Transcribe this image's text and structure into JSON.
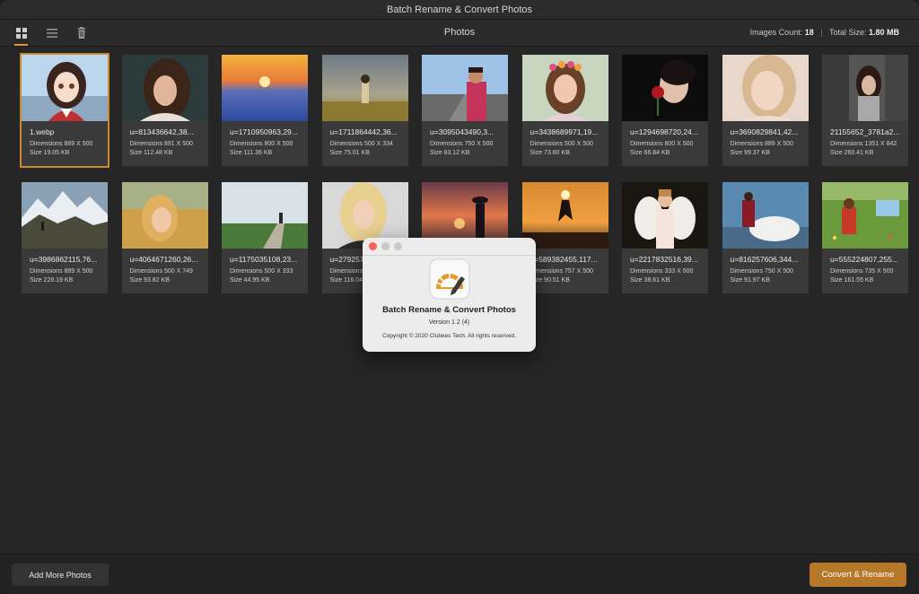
{
  "window": {
    "title": "Batch Rename & Convert Photos"
  },
  "toolbar": {
    "title": "Photos",
    "images_count_label": "Images Count:",
    "images_count_value": "18",
    "total_size_label": "Total Size:",
    "total_size_value": "1.80 MB",
    "view_mode": "grid"
  },
  "photos": [
    {
      "name": "1.webp",
      "dimensions": "Dimensions 889 X 500",
      "size": "Size 19.05 KB",
      "selected": true,
      "thumb": "anime-girl"
    },
    {
      "name": "u=813436642,38...",
      "dimensions": "Dimensions 891 X 500",
      "size": "Size 112.48 KB",
      "thumb": "woman-portrait"
    },
    {
      "name": "u=1710950963,29...",
      "dimensions": "Dimensions 800 X 500",
      "size": "Size 111.36 KB",
      "thumb": "sunset-clouds"
    },
    {
      "name": "u=1711864442,36...",
      "dimensions": "Dimensions 500 X 334",
      "size": "Size 75.01 KB",
      "thumb": "girl-field"
    },
    {
      "name": "u=3095043490,3...",
      "dimensions": "Dimensions 750 X 500",
      "size": "Size 83.12 KB",
      "thumb": "man-road"
    },
    {
      "name": "u=3438689971,19...",
      "dimensions": "Dimensions 500 X 500",
      "size": "Size 73.80 KB",
      "thumb": "girl-flowers"
    },
    {
      "name": "u=1294698720,24...",
      "dimensions": "Dimensions 800 X 500",
      "size": "Size 66.84 KB",
      "thumb": "woman-rose"
    },
    {
      "name": "u=3690829841,42...",
      "dimensions": "Dimensions 889 X 500",
      "size": "Size 99.37 KB",
      "thumb": "blonde-face"
    },
    {
      "name": "21155652_3781a2...",
      "dimensions": "Dimensions 1351 X 842",
      "size": "Size 260.41 KB",
      "thumb": "woman-train"
    },
    {
      "name": "u=3986862115,76...",
      "dimensions": "Dimensions 889 X 500",
      "size": "Size 228.19 KB",
      "thumb": "mountains"
    },
    {
      "name": "u=4064671260,26...",
      "dimensions": "Dimensions 500 X 749",
      "size": "Size 93.82 KB",
      "thumb": "girl-golden"
    },
    {
      "name": "u=1175035108,23...",
      "dimensions": "Dimensions 500 X 333",
      "size": "Size 44.95 KB",
      "thumb": "road-green"
    },
    {
      "name": "u=279257...",
      "dimensions": "Dimensions ...",
      "size": "Size 116.04...",
      "thumb": "blonde-woman"
    },
    {
      "name": "",
      "dimensions": "",
      "size": "",
      "thumb": "sunset-silhouette"
    },
    {
      "name": "u=589382455,117...",
      "dimensions": "Dimensions 757 X 500",
      "size": "Size 90.51 KB",
      "thumb": "jump-sunset"
    },
    {
      "name": "u=2217832516,39...",
      "dimensions": "Dimensions 333 X 500",
      "size": "Size 38.61 KB",
      "thumb": "angel-girl"
    },
    {
      "name": "u=816257606,344...",
      "dimensions": "Dimensions 750 X 500",
      "size": "Size 91.97 KB",
      "thumb": "girl-horse"
    },
    {
      "name": "u=555224807,255...",
      "dimensions": "Dimensions 735 X 500",
      "size": "Size 161.55 KB",
      "thumb": "girl-meadow"
    }
  ],
  "buttons": {
    "add_more": "Add More Photos",
    "convert": "Convert & Rename"
  },
  "about": {
    "app_name": "Batch Rename & Convert Photos",
    "version": "Version 1.2 (4)",
    "copyright": "Copyright © 2020 Clubees Tech. All rights reserved."
  },
  "colors": {
    "accent": "#c98a2b",
    "convert_button": "#b7782a",
    "background": "#262626",
    "card": "#3a3a3a"
  }
}
